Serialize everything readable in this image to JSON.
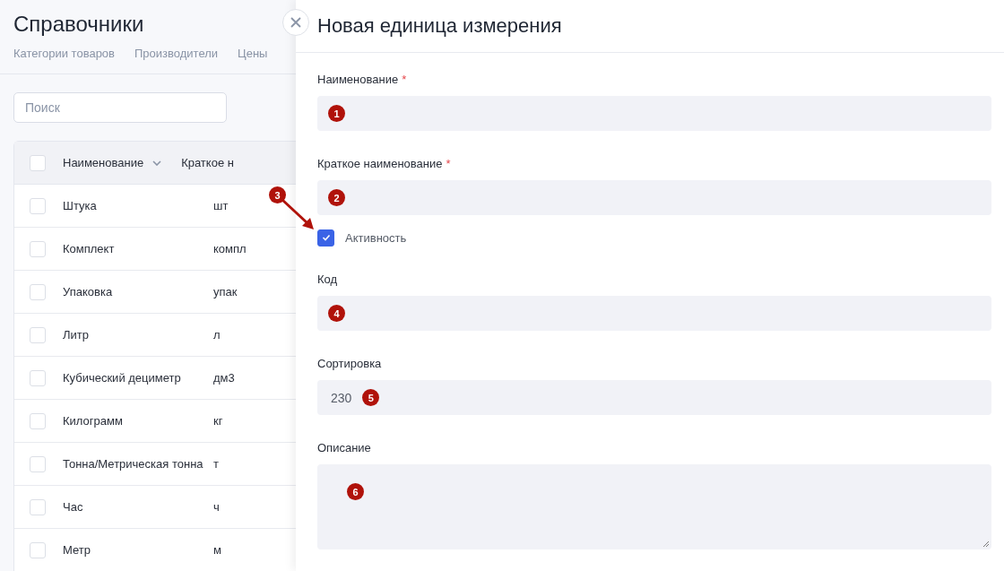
{
  "page": {
    "title": "Справочники",
    "tabs": [
      {
        "label": "Категории товаров",
        "selected": false
      },
      {
        "label": "Производители",
        "selected": false
      },
      {
        "label": "Цены",
        "selected": false
      }
    ],
    "search": {
      "placeholder": "Поиск"
    },
    "table": {
      "columns": [
        "Наименование",
        "Краткое н"
      ],
      "all_checked": false,
      "rows": [
        {
          "name": "Штука",
          "short": "шт",
          "checked": false
        },
        {
          "name": "Комплект",
          "short": "компл",
          "checked": false
        },
        {
          "name": "Упаковка",
          "short": "упак",
          "checked": false
        },
        {
          "name": "Литр",
          "short": "л",
          "checked": false
        },
        {
          "name": "Кубический дециметр",
          "short": "дм3",
          "checked": false
        },
        {
          "name": "Килограмм",
          "short": "кг",
          "checked": false
        },
        {
          "name": "Тонна/Метрическая тонна",
          "short": "т",
          "checked": false
        },
        {
          "name": "Час",
          "short": "ч",
          "checked": false
        },
        {
          "name": "Метр",
          "short": "м",
          "checked": false
        }
      ]
    }
  },
  "panel": {
    "title": "Новая единица измерения",
    "fields": [
      {
        "kind": "text",
        "label": "Наименование",
        "required_mark": "*",
        "marker": "1"
      },
      {
        "kind": "text",
        "label": "Краткое наименование",
        "required_mark": "*",
        "marker": "2"
      },
      {
        "kind": "checkbox",
        "label": "Активность",
        "checked": true,
        "marker": "3"
      },
      {
        "kind": "text",
        "label": "Код",
        "marker": "4"
      },
      {
        "kind": "text",
        "label": "Сортировка",
        "value": "230",
        "marker": "5"
      },
      {
        "kind": "textarea",
        "label": "Описание",
        "marker": "6"
      }
    ]
  }
}
